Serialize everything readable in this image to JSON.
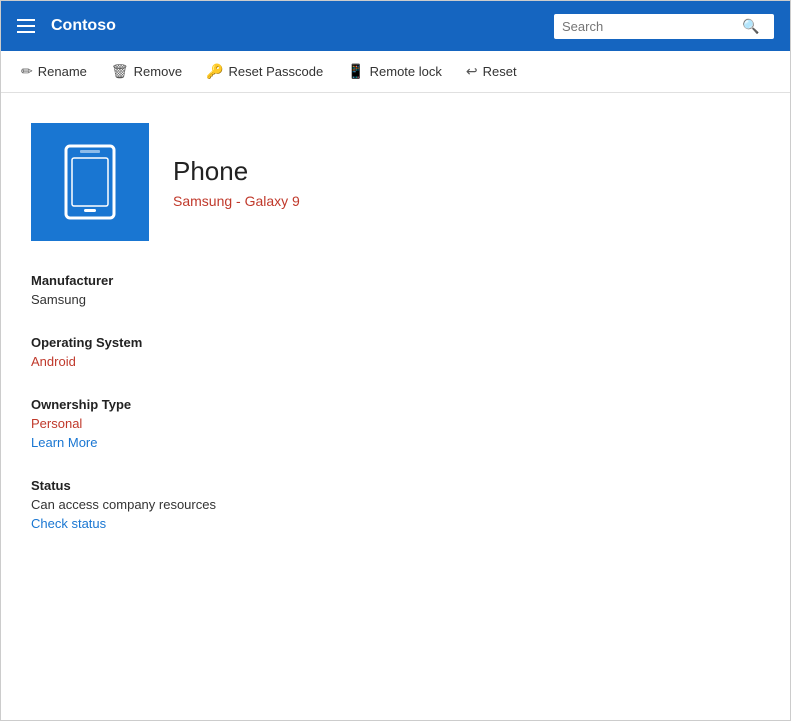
{
  "header": {
    "brand": "Contoso",
    "search_placeholder": "Search"
  },
  "toolbar": {
    "items": [
      {
        "id": "rename",
        "label": "Rename",
        "icon": "✏"
      },
      {
        "id": "remove",
        "label": "Remove",
        "icon": "🗑"
      },
      {
        "id": "reset-passcode",
        "label": "Reset Passcode",
        "icon": "🔑"
      },
      {
        "id": "remote-lock",
        "label": "Remote lock",
        "icon": "📱"
      },
      {
        "id": "reset",
        "label": "Reset",
        "icon": "↩"
      }
    ]
  },
  "device": {
    "name": "Phone",
    "model": "Samsung - Galaxy 9",
    "icon_label": "phone-icon"
  },
  "details": {
    "manufacturer_label": "Manufacturer",
    "manufacturer_value": "Samsung",
    "os_label": "Operating System",
    "os_value": "Android",
    "ownership_label": "Ownership Type",
    "ownership_value": "Personal",
    "ownership_link": "Learn More",
    "status_label": "Status",
    "status_value": "Can access company resources",
    "status_link": "Check status"
  }
}
